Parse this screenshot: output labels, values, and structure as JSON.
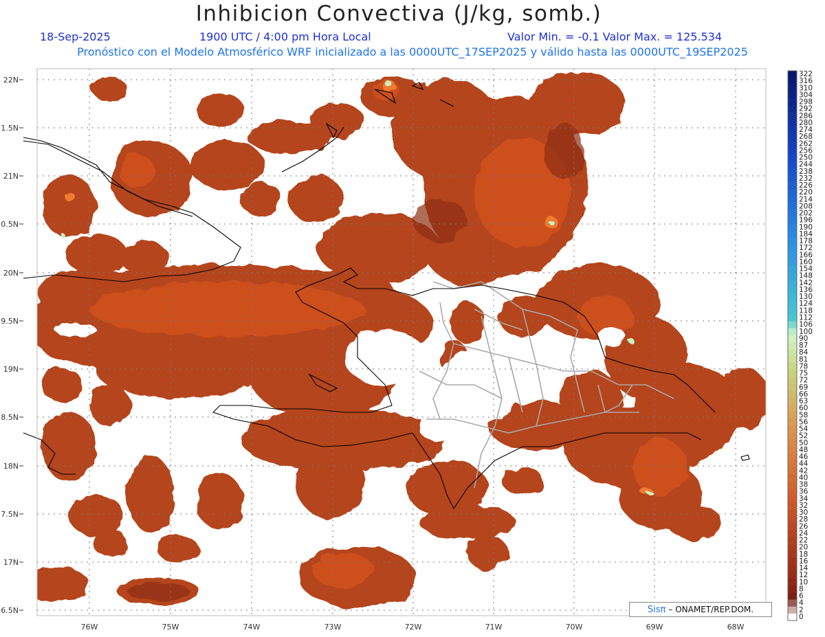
{
  "header": {
    "title": "Inhibicion Convectiva (J/kg, somb.)",
    "date": "18-Sep-2025",
    "time": "1900 UTC / 4:00 pm Hora Local",
    "minmax": "Valor Min. = -0.1  Valor Max. = 125.534",
    "model_line": "Pronóstico con el Modelo Atmosférico WRF inicializado a las 0000UTC_17SEP2025 y válido hasta las  0000UTC_19SEP2025"
  },
  "axes": {
    "lat_labels": [
      "22N",
      "1.5N",
      "21N",
      "0.5N",
      "20N",
      "9.5N",
      "19N",
      "8.5N",
      "18N",
      "7.5N",
      "17N",
      "6.5N"
    ],
    "lon_labels": [
      "76W",
      "75W",
      "74W",
      "73W",
      "72W",
      "71W",
      "70W",
      "69W",
      "68W"
    ]
  },
  "colorbar": {
    "labels": [
      "322",
      "316",
      "310",
      "304",
      "298",
      "292",
      "286",
      "280",
      "274",
      "268",
      "262",
      "256",
      "250",
      "244",
      "238",
      "232",
      "226",
      "220",
      "214",
      "208",
      "202",
      "196",
      "190",
      "184",
      "178",
      "172",
      "166",
      "160",
      "154",
      "148",
      "142",
      "136",
      "130",
      "124",
      "118",
      "112",
      "106",
      "100",
      "90",
      "87",
      "84",
      "81",
      "78",
      "75",
      "72",
      "69",
      "66",
      "63",
      "60",
      "58",
      "56",
      "54",
      "52",
      "50",
      "48",
      "46",
      "44",
      "42",
      "40",
      "38",
      "36",
      "34",
      "32",
      "30",
      "28",
      "26",
      "24",
      "22",
      "20",
      "18",
      "16",
      "14",
      "12",
      "10",
      "8",
      "6",
      "4",
      "2",
      "0"
    ]
  },
  "credit": {
    "brand": "Sisπ",
    "text": "– ONAMET/REP.DOM."
  },
  "colors": {
    "fill_main": "#b5441a",
    "fill_dark": "#8e2e12",
    "fill_hot": "#e6601c",
    "peak": "#c8f0c0",
    "coast": "#000000",
    "borders": "#a9a9a9"
  }
}
